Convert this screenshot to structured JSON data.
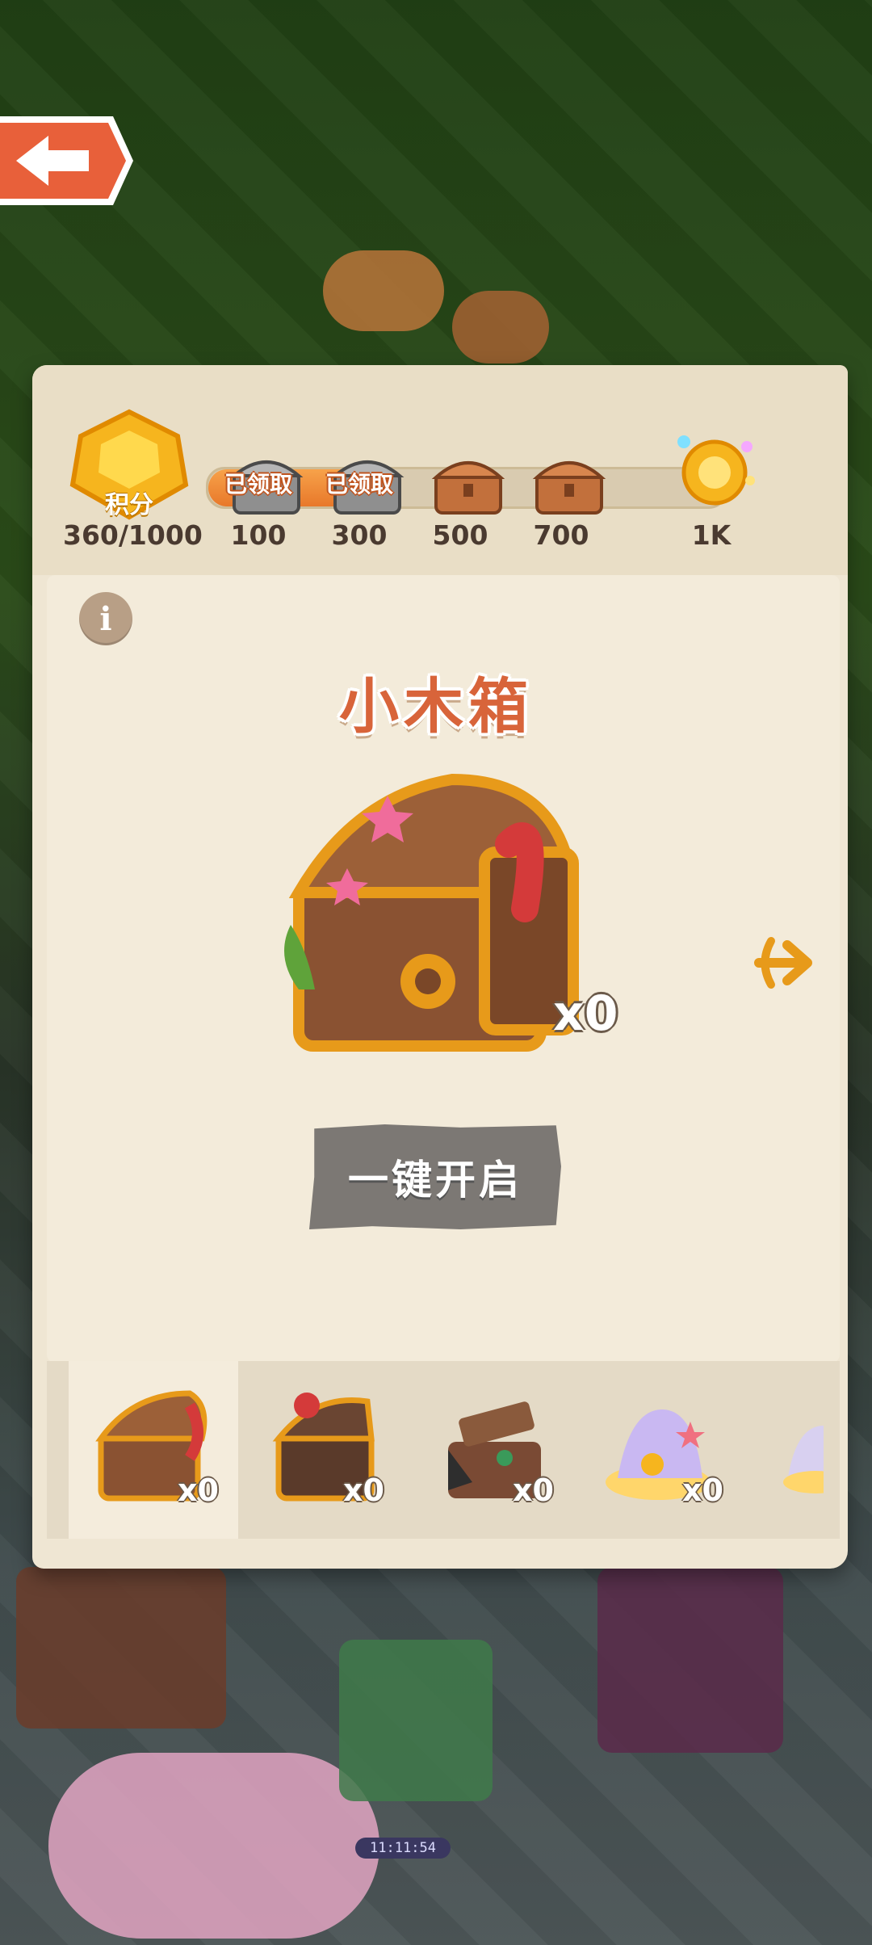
{
  "score": {
    "label": "积分",
    "value": "360/1000",
    "progress": 0.36
  },
  "milestones": [
    {
      "value": "100",
      "claimed_tag": "已领取",
      "kind": "silver-chest"
    },
    {
      "value": "300",
      "claimed_tag": "已领取",
      "kind": "silver-chest"
    },
    {
      "value": "500",
      "claimed_tag": "",
      "kind": "bronze-chest"
    },
    {
      "value": "700",
      "claimed_tag": "",
      "kind": "bronze-chest"
    },
    {
      "value": "1K",
      "claimed_tag": "",
      "kind": "gold-shell"
    }
  ],
  "chest": {
    "title": "小木箱",
    "count": "x0"
  },
  "open_all_button": "一键开启",
  "tabs": [
    {
      "count": "x0",
      "kind": "wooden-chest"
    },
    {
      "count": "x0",
      "kind": "dark-chest"
    },
    {
      "count": "x0",
      "kind": "pirate-chest"
    },
    {
      "count": "x0",
      "kind": "shell-chest"
    },
    {
      "count": "",
      "kind": "partial-chest"
    }
  ],
  "timer": "11:11:54",
  "colors": {
    "title": "#d8643a",
    "parchment": "#efe6d3",
    "gold": "#f6b51e",
    "button_disabled": "#7c7874"
  }
}
